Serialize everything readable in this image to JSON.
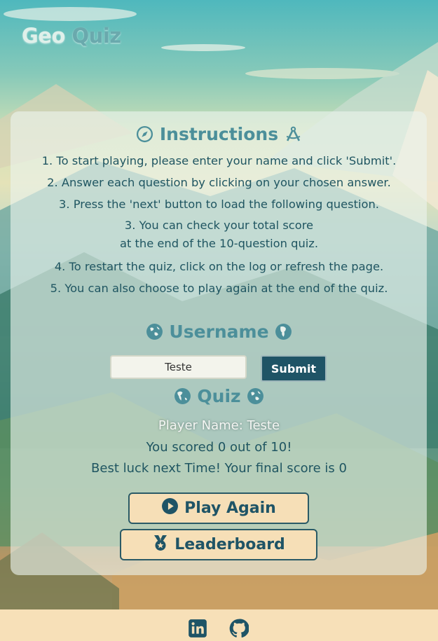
{
  "logo": {
    "part1": "Geo",
    "part2": "Quiz"
  },
  "instructions": {
    "heading": "Instructions",
    "items": [
      "1. To start playing, please enter your name and click 'Submit'.",
      "2. Answer each question by clicking on your chosen answer.",
      "3. Press the 'next' button to load the following question.",
      "3. You can check your total score\nat the end of the 10-question quiz.",
      "4. To restart the quiz, click on the log or refresh the page.",
      "5. You can also choose to play again at the end of the quiz."
    ]
  },
  "username": {
    "heading": "Username",
    "input_value": "Teste",
    "submit_label": "Submit"
  },
  "quiz": {
    "heading": "Quiz",
    "player_name": "Player Name: Teste",
    "score_text": "You scored 0 out of 10!",
    "final_text": "Best luck next Time! Your final score is 0"
  },
  "buttons": {
    "play_again": "Play Again",
    "leaderboard": "Leaderboard"
  },
  "colors": {
    "accent": "#1f5466",
    "heading": "#4c8f9a",
    "button_bg": "#f6dfb7",
    "footer_bg": "#f7e0b8"
  },
  "icons": {
    "instructions_left": "compass-icon",
    "instructions_right": "drafting-compass-icon",
    "username_left": "globe-asia-icon",
    "username_right": "globe-africa-icon",
    "quiz_left": "globe-americas-icon",
    "quiz_right": "globe-asia-icon",
    "play_again": "circle-play-icon",
    "leaderboard": "medal-icon",
    "footer": [
      "linkedin-icon",
      "github-icon"
    ]
  }
}
